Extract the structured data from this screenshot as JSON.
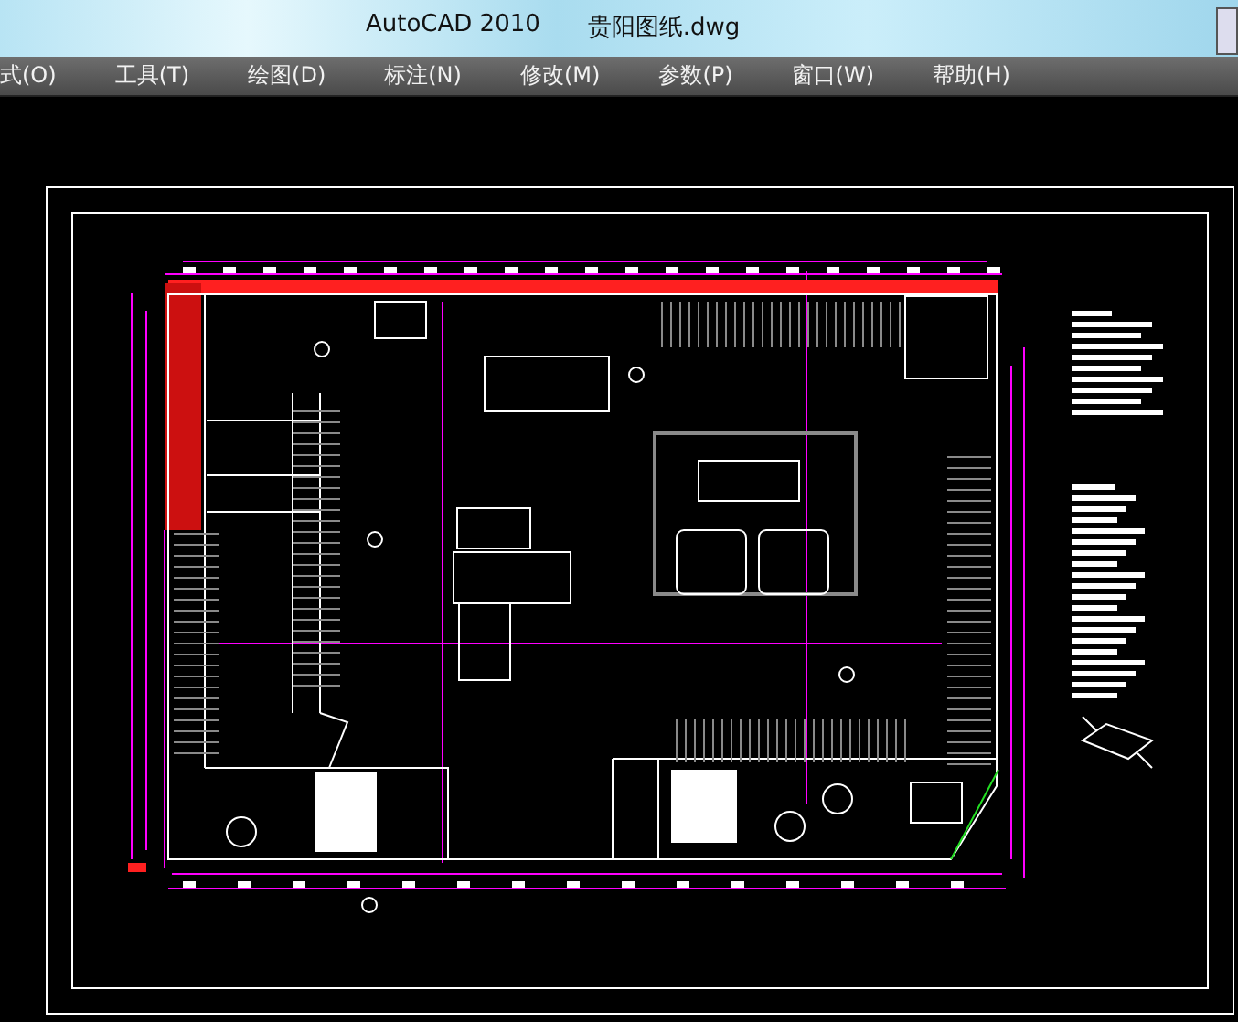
{
  "window": {
    "app": "AutoCAD 2010",
    "file": "贵阳图纸.dwg"
  },
  "menu": [
    {
      "label": "式(O)"
    },
    {
      "label": "工具(T)"
    },
    {
      "label": "绘图(D)"
    },
    {
      "label": "标注(N)"
    },
    {
      "label": "修改(M)"
    },
    {
      "label": "参数(P)"
    },
    {
      "label": "窗口(W)"
    },
    {
      "label": "帮助(H)"
    }
  ]
}
